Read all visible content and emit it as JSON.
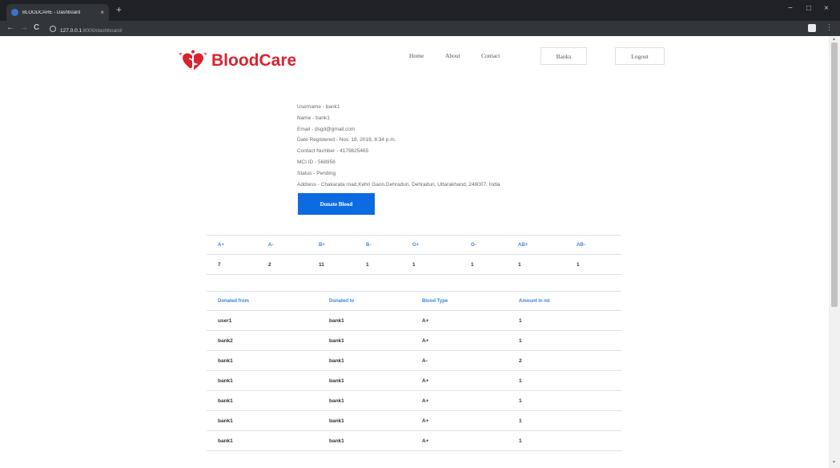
{
  "browser": {
    "tab_title": "BLOODCARE - Dashboard",
    "tab_close": "×",
    "new_tab": "+",
    "url_host": "127.0.0.1",
    "url_path": ":8000/dashboard/",
    "back": "←",
    "forward": "→",
    "reload": "C",
    "minimize": "−",
    "maximize": "□",
    "close": "×",
    "menu": "⋮"
  },
  "header": {
    "logo_text": "BloodCare",
    "nav": [
      "Home",
      "About",
      "Contact"
    ],
    "banks_label": "Banks",
    "logout_label": "Logout"
  },
  "profile": {
    "lines": [
      "Username - bank1",
      "Name - bank1",
      "Email - dsgd@gmail.com",
      "Date Registered - Nov. 18, 2019, 8:34 p.m.",
      "Contact Number - 4179825465",
      "MCI ID - 568956",
      "Status - Pending",
      "Address - Chakarata road,Kehri Gaon,Dehradun, Dehradun, Uttarakhand, 248007, India"
    ],
    "donate_label": "Donate Blood"
  },
  "blood_stock": {
    "headers": [
      "A+",
      "A-",
      "B+",
      "B-",
      "O+",
      "O-",
      "AB+",
      "AB-"
    ],
    "values": [
      "7",
      "2",
      "11",
      "1",
      "1",
      "1",
      "1",
      "1"
    ]
  },
  "donations": {
    "headers": [
      "Donated from",
      "Donated to",
      "Blood Type",
      "Amount in ml"
    ],
    "rows": [
      [
        "user1",
        "bank1",
        "A+",
        "1"
      ],
      [
        "bank2",
        "bank1",
        "A+",
        "1"
      ],
      [
        "bank1",
        "bank1",
        "A-",
        "2"
      ],
      [
        "bank1",
        "bank1",
        "A+",
        "1"
      ],
      [
        "bank1",
        "bank1",
        "A+",
        "1"
      ],
      [
        "bank1",
        "bank1",
        "A+",
        "1"
      ],
      [
        "bank1",
        "bank1",
        "A+",
        "1"
      ]
    ]
  },
  "colors": {
    "brand": "#d9232e",
    "accent": "#0c6be0",
    "header_text": "#3a86d8"
  }
}
